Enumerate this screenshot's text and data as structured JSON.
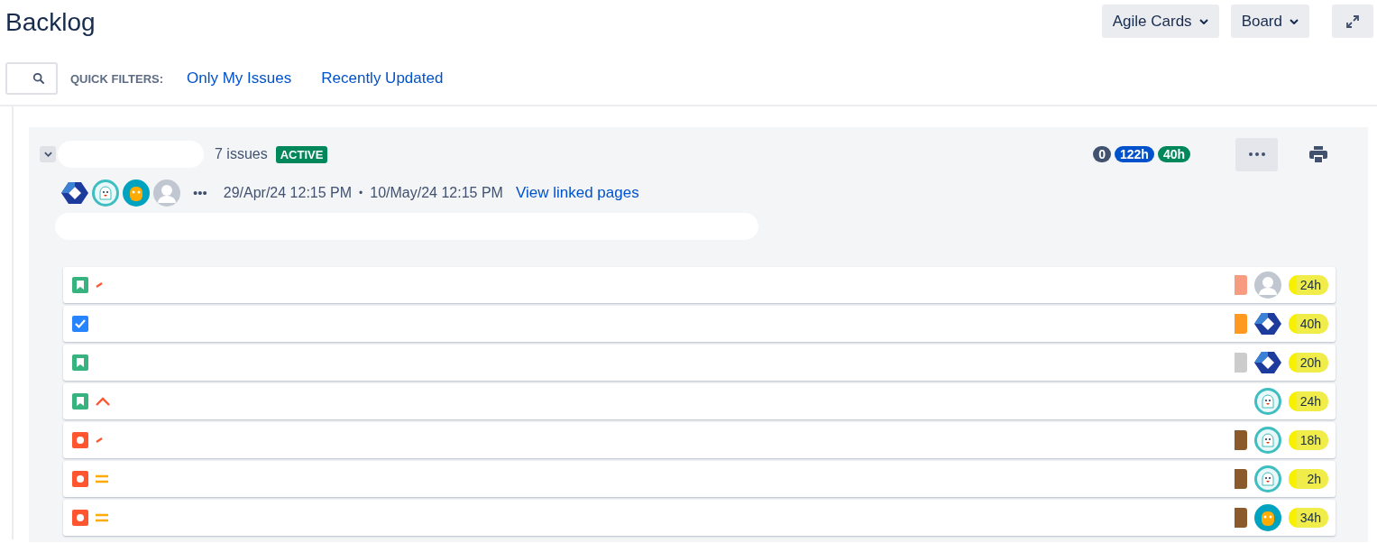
{
  "page": {
    "title": "Backlog"
  },
  "header_buttons": [
    {
      "kind": "dropdown",
      "label": "Agile Cards"
    },
    {
      "kind": "dropdown",
      "label": "Board"
    },
    {
      "kind": "expand"
    }
  ],
  "quick_filters": {
    "label": "QUICK FILTERS:",
    "items": [
      "Only My Issues",
      "Recently Updated"
    ]
  },
  "sprint": {
    "expanded": true,
    "issue_count": "7 issues",
    "status": "ACTIVE",
    "badges": [
      {
        "text": "0",
        "color": "#42526e"
      },
      {
        "text": "122h",
        "color": "#0052cc"
      },
      {
        "text": "40h",
        "color": "#00875a"
      }
    ],
    "members": [
      {
        "kind": "hex"
      },
      {
        "kind": "ghost"
      },
      {
        "kind": "robot"
      },
      {
        "kind": "default"
      }
    ],
    "more": "•••",
    "start": "29/Apr/24 12:15 PM",
    "separator": "•",
    "end": "10/May/24 12:15 PM",
    "link": "View linked pages"
  },
  "issues": [
    {
      "kind": "story",
      "priority": {
        "kind": "partial"
      },
      "tag": {
        "color": "#f79c80"
      },
      "avatar": {
        "kind": "default"
      },
      "estimate": "24h"
    },
    {
      "kind": "task",
      "tag": {
        "color": "#ff991f"
      },
      "avatar": {
        "kind": "hex"
      },
      "estimate": "40h"
    },
    {
      "kind": "story",
      "tag": {
        "color": "#cccccc"
      },
      "avatar": {
        "kind": "hex"
      },
      "estimate": "20h"
    },
    {
      "kind": "story",
      "priority": {
        "kind": "high"
      },
      "avatar": {
        "kind": "ghost"
      },
      "estimate": "24h"
    },
    {
      "kind": "bug",
      "priority": {
        "kind": "partial"
      },
      "tag": {
        "color": "#8b5a2b"
      },
      "avatar": {
        "kind": "ghost"
      },
      "estimate": "18h"
    },
    {
      "kind": "bug",
      "priority": {
        "kind": "medium"
      },
      "tag": {
        "color": "#8b5a2b"
      },
      "avatar": {
        "kind": "ghost"
      },
      "estimate": "2h"
    },
    {
      "kind": "bug",
      "priority": {
        "kind": "medium"
      },
      "tag": {
        "color": "#8b5a2b"
      },
      "avatar": {
        "kind": "robot"
      },
      "estimate": "34h"
    }
  ]
}
